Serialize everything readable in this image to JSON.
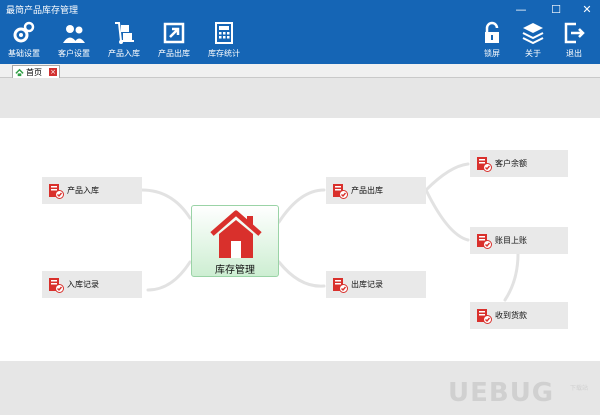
{
  "window": {
    "title": "最简产品库存管理",
    "min": "—",
    "max": "☐",
    "close": "✕"
  },
  "toolbar": {
    "left": [
      {
        "label": "基础设置",
        "icon": "gears-icon"
      },
      {
        "label": "客户设置",
        "icon": "users-icon"
      },
      {
        "label": "产品入库",
        "icon": "hand-truck-icon"
      },
      {
        "label": "产品出库",
        "icon": "export-arrow-icon"
      },
      {
        "label": "库存统计",
        "icon": "calculator-icon"
      }
    ],
    "right": [
      {
        "label": "锁屏",
        "icon": "lock-icon"
      },
      {
        "label": "关于",
        "icon": "layers-icon"
      },
      {
        "label": "退出",
        "icon": "exit-icon"
      }
    ]
  },
  "tab": {
    "label": "首页"
  },
  "flow": {
    "center": "库存管理",
    "nodes": [
      {
        "key": "product_in",
        "label": "产品入库"
      },
      {
        "key": "in_record",
        "label": "入库记录"
      },
      {
        "key": "product_out",
        "label": "产品出库"
      },
      {
        "key": "out_record",
        "label": "出库记录"
      },
      {
        "key": "customer_balance",
        "label": "客户余额"
      },
      {
        "key": "ledger",
        "label": "账目上账"
      },
      {
        "key": "receive_payment",
        "label": "收到货款"
      }
    ]
  },
  "watermark": {
    "text": "UEBUG",
    "sub": "下载站"
  },
  "colors": {
    "toolbar": "#1565b5",
    "node": "#e9e9e9",
    "band": "#e6e6e6",
    "house": "#d9302c"
  }
}
